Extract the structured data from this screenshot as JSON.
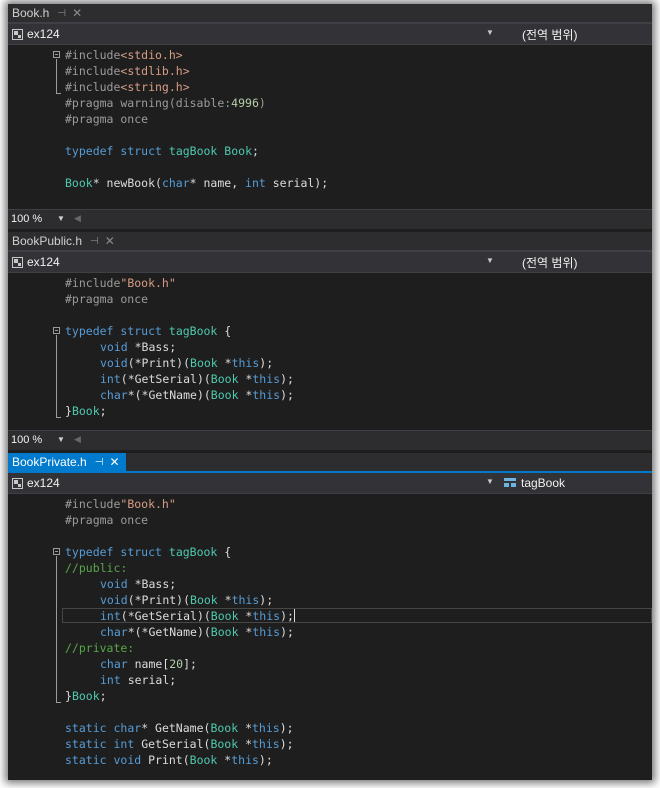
{
  "panes": [
    {
      "tab": {
        "title": "Book.h",
        "pin": "⊣",
        "close": "✕"
      },
      "nav": {
        "project": "ex124",
        "scope": "(전역 범위)"
      },
      "zoom": "100 %"
    },
    {
      "tab": {
        "title": "BookPublic.h",
        "pin": "⊣",
        "close": "✕"
      },
      "nav": {
        "project": "ex124",
        "scope": "(전역 범위)"
      },
      "zoom": "100 %"
    },
    {
      "tab": {
        "title": "BookPrivate.h",
        "pin": "⊣",
        "close": "✕"
      },
      "nav": {
        "project": "ex124",
        "scope": "tagBook"
      }
    }
  ],
  "code": {
    "book_h": {
      "l1": [
        "#include",
        "<stdio.h>"
      ],
      "l2": [
        "#include",
        "<stdlib.h>"
      ],
      "l3": [
        "#include",
        "<string.h>"
      ],
      "l4": [
        "#pragma warning(disable:",
        "4996",
        ")"
      ],
      "l5": "#pragma once",
      "l6": [
        "typedef",
        " ",
        "struct",
        " ",
        "tagBook",
        " ",
        "Book",
        ";"
      ],
      "l7": [
        "Book",
        "* newBook(",
        "char",
        "* name, ",
        "int",
        " serial);"
      ]
    },
    "bookpublic_h": {
      "l1": [
        "#include",
        "\"Book.h\""
      ],
      "l2": "#pragma once",
      "l3": [
        "typedef",
        " ",
        "struct",
        " ",
        "tagBook",
        " {"
      ],
      "l4": [
        "void",
        " *Bass;"
      ],
      "l5": [
        "void",
        "(*Print)(",
        "Book",
        " *",
        "this",
        ");"
      ],
      "l6": [
        "int",
        "(*GetSerial)(",
        "Book",
        " *",
        "this",
        ");"
      ],
      "l7": [
        "char",
        "*(*GetName)(",
        "Book",
        " *",
        "this",
        ");"
      ],
      "l8": [
        "}",
        "Book",
        ";"
      ]
    },
    "bookprivate_h": {
      "l1": [
        "#include",
        "\"Book.h\""
      ],
      "l2": "#pragma once",
      "l3": [
        "typedef",
        " ",
        "struct",
        " ",
        "tagBook",
        " {"
      ],
      "l4": "//public:",
      "l5": [
        "void",
        " *Bass;"
      ],
      "l6": [
        "void",
        "(*Print)(",
        "Book",
        " *",
        "this",
        ");"
      ],
      "l7": [
        "int",
        "(*GetSerial)(",
        "Book",
        " *",
        "this",
        ");"
      ],
      "l8": [
        "char",
        "*(*GetName)(",
        "Book",
        " *",
        "this",
        ");"
      ],
      "l9": "//private:",
      "l10": [
        "char",
        " name[",
        "20",
        "];"
      ],
      "l11": [
        "int",
        " serial;"
      ],
      "l12": [
        "}",
        "Book",
        ";"
      ],
      "l13": [
        "static",
        " ",
        "char",
        "* GetName(",
        "Book",
        " *",
        "this",
        ");"
      ],
      "l14": [
        "static",
        " ",
        "int",
        " GetSerial(",
        "Book",
        " *",
        "this",
        ");"
      ],
      "l15": [
        "static",
        " ",
        "void",
        " Print(",
        "Book",
        " *",
        "this",
        ");"
      ]
    }
  },
  "colors": {
    "keyword": "#569cd6",
    "type": "#4ec9b0",
    "string": "#d69d85",
    "comment": "#57a64a",
    "number": "#b5cea8",
    "preprocessor": "#9b9b9b",
    "active_tab": "#007acc"
  }
}
